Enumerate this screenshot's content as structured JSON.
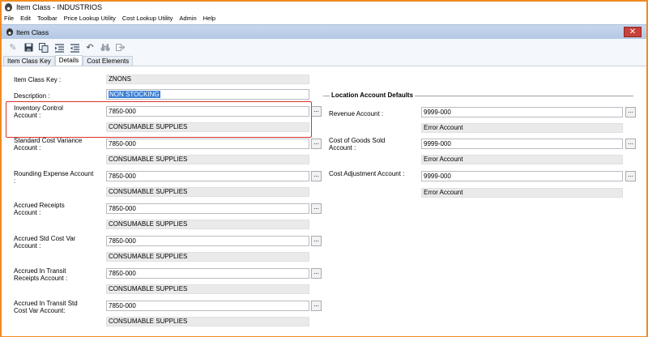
{
  "window": {
    "title": "Item Class - INDUSTRIOS"
  },
  "menu": [
    "File",
    "Edit",
    "Toolbar",
    "Price Lookup Utility",
    "Cost Lookup Utility",
    "Admin",
    "Help"
  ],
  "child": {
    "title": "Item Class",
    "close": "✕"
  },
  "toolbar": {
    "icons": [
      "edit-icon",
      "save-icon",
      "copy-icon",
      "indent-icon",
      "outdent-icon",
      "undo-icon",
      "binoculars-icon",
      "export-icon"
    ]
  },
  "tabs": [
    "Item Class Key",
    "Details",
    "Cost Elements"
  ],
  "form": {
    "item_class_key_label": "Item Class Key :",
    "item_class_key_value": "ZNONS",
    "description_label": "Description :",
    "description_value": "NON STOCKING",
    "lookup_label": "...",
    "fields": [
      {
        "label1": "Inventory Control",
        "label2": "Account :",
        "value": "7850-000",
        "desc": "CONSUMABLE SUPPLIES"
      },
      {
        "label1": "Standard Cost Variance",
        "label2": "Account :",
        "value": "7850-000",
        "desc": "CONSUMABLE SUPPLIES"
      },
      {
        "label1": "Rounding Expense Account",
        "label2": ":",
        "value": "7850-000",
        "desc": "CONSUMABLE SUPPLIES"
      },
      {
        "label1": "Accrued Receipts",
        "label2": "Account :",
        "value": "7850-000",
        "desc": "CONSUMABLE SUPPLIES"
      },
      {
        "label1": "Accrued Std Cost Var",
        "label2": "Account :",
        "value": "7850-000",
        "desc": "CONSUMABLE SUPPLIES"
      },
      {
        "label1": "Accrued In Transit",
        "label2": "Receipts Account :",
        "value": "7850-000",
        "desc": "CONSUMABLE SUPPLIES"
      },
      {
        "label1": "Accrued In Transit Std",
        "label2": "Cost Var Account:",
        "value": "7850-000",
        "desc": "CONSUMABLE SUPPLIES"
      }
    ],
    "location_section_title": "Location Account Defaults",
    "location_fields": [
      {
        "label1": "Revenue Account :",
        "label2": "",
        "value": "9999-000",
        "desc": "Error Account"
      },
      {
        "label1": "Cost of Goods Sold",
        "label2": "Account :",
        "value": "9999-000",
        "desc": "Error Account"
      },
      {
        "label1": "Cost Adjustment Account :",
        "label2": "",
        "value": "9999-000",
        "desc": "Error Account"
      }
    ]
  },
  "colors": {
    "frame": "#f08a24",
    "highlight": "#d9342b",
    "titlebar": "#b5c8e4",
    "close": "#c8413b"
  }
}
